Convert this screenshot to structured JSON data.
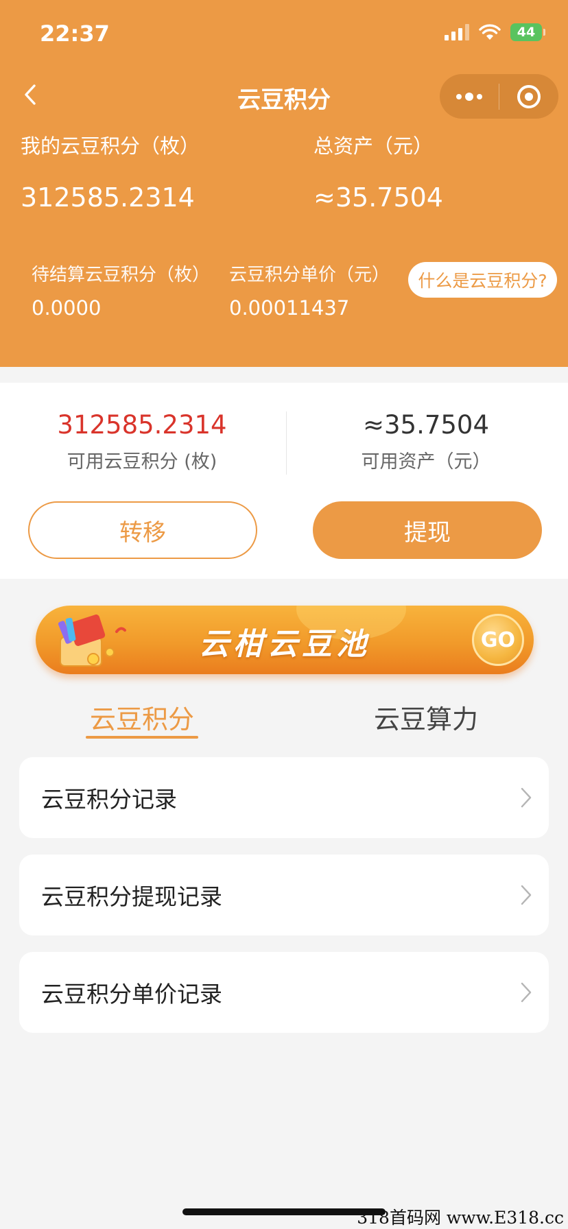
{
  "status_bar": {
    "time": "22:37",
    "battery": "44"
  },
  "nav": {
    "title": "云豆积分"
  },
  "header": {
    "my_points_label": "我的云豆积分（枚）",
    "my_points_value": "312585.2314",
    "total_assets_label": "总资产（元）",
    "total_assets_value": "≈35.7504",
    "pending_label": "待结算云豆积分（枚）",
    "pending_value": "0.0000",
    "unit_price_label": "云豆积分单价（元）",
    "unit_price_value": "0.00011437",
    "what_is_link": "什么是云豆积分?"
  },
  "balance": {
    "available_points_value": "312585.2314",
    "available_points_label": "可用云豆积分 (枚)",
    "available_assets_value": "≈35.7504",
    "available_assets_label": "可用资产（元）",
    "transfer_button": "转移",
    "withdraw_button": "提现"
  },
  "banner": {
    "title": "云柑云豆池",
    "go_label": "GO"
  },
  "tabs": [
    {
      "label": "云豆积分",
      "active": true
    },
    {
      "label": "云豆算力",
      "active": false
    }
  ],
  "list": [
    {
      "label": "云豆积分记录"
    },
    {
      "label": "云豆积分提现记录"
    },
    {
      "label": "云豆积分单价记录"
    }
  ],
  "watermark": "318首码网 www.E318.cc",
  "colors": {
    "accent": "#ec9a45",
    "red_value": "#d9342b",
    "background": "#f4f4f4"
  }
}
